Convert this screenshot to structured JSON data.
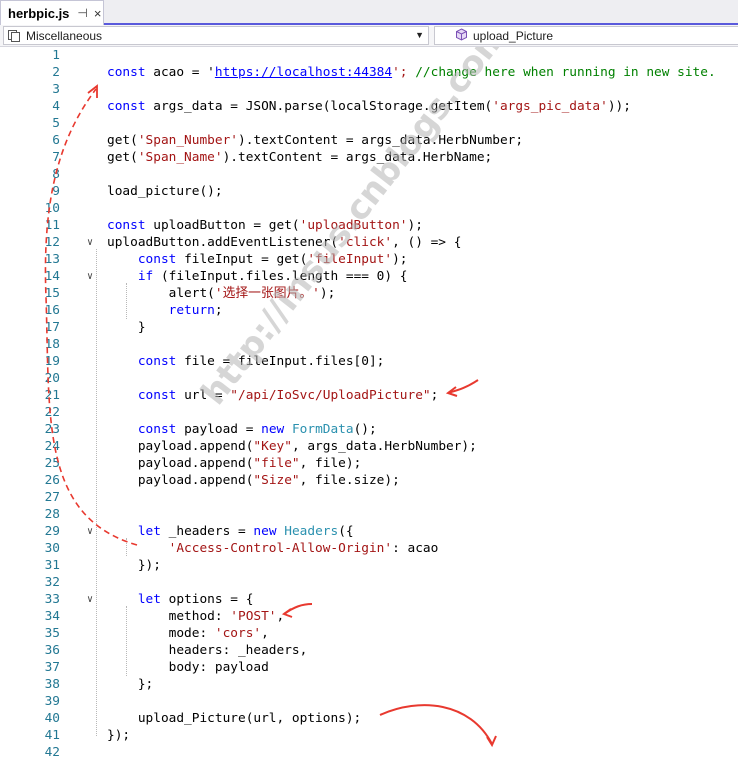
{
  "tab": {
    "title": "herbpic.js",
    "pin": "⊣",
    "close": "×"
  },
  "navbar": {
    "scope": "Miscellaneous",
    "member": "upload_Picture"
  },
  "colors": {
    "keyword": "#0000ff",
    "string": "#a31515",
    "comment": "#008000",
    "line_number": "#237893",
    "annotation": "#e8392f"
  },
  "watermark": "http://insus.cnblogs.com",
  "code": {
    "l2": {
      "kw": "const",
      "a": " acao = '",
      "url": "https://localhost:44384",
      "b": "'; ",
      "cmt": "//change here when running in new site."
    },
    "l4": {
      "kw": "const",
      "a": " args_data = JSON.parse(localStorage.getItem(",
      "s1": "'args_pic_data'",
      "b": "));"
    },
    "l6": {
      "a": "get(",
      "s1": "'Span_Number'",
      "b": ").textContent = args_data.HerbNumber;"
    },
    "l7": {
      "a": "get(",
      "s1": "'Span_Name'",
      "b": ").textContent = args_data.HerbName;"
    },
    "l9": {
      "a": "load_picture();"
    },
    "l11": {
      "kw": "const",
      "a": " uploadButton = get(",
      "s1": "'uploadButton'",
      "b": ");"
    },
    "l12": {
      "a": "uploadButton.addEventListener(",
      "s1": "'click'",
      "b": ", () => {"
    },
    "l13": {
      "ind": "    ",
      "kw": "const",
      "a": " fileInput = get(",
      "s1": "'fileInput'",
      "b": ");"
    },
    "l14": {
      "ind": "    ",
      "kw": "if",
      "a": " (fileInput.files.length === 0) {"
    },
    "l15": {
      "ind": "        ",
      "a": "alert(",
      "s1": "'选择一张图片。'",
      "b": ");"
    },
    "l16": {
      "ind": "        ",
      "kw": "return",
      "a": ";"
    },
    "l17": {
      "ind": "    ",
      "a": "}"
    },
    "l19": {
      "ind": "    ",
      "kw": "const",
      "a": " file = fileInput.files[0];"
    },
    "l21": {
      "ind": "    ",
      "kw": "const",
      "a": " url = ",
      "s1": "\"/api/IoSvc/UploadPicture\"",
      "b": ";"
    },
    "l23": {
      "ind": "    ",
      "kw": "const",
      "a": " payload = ",
      "kw2": "new",
      "sp": " ",
      "ty": "FormData",
      "b": "();"
    },
    "l24": {
      "ind": "    ",
      "a": "payload.append(",
      "s1": "\"Key\"",
      "b": ", args_data.HerbNumber);"
    },
    "l25": {
      "ind": "    ",
      "a": "payload.append(",
      "s1": "\"file\"",
      "b": ", file);"
    },
    "l26": {
      "ind": "    ",
      "a": "payload.append(",
      "s1": "\"Size\"",
      "b": ", file.size);"
    },
    "l29": {
      "ind": "    ",
      "kw": "let",
      "a": " _headers = ",
      "kw2": "new",
      "sp": " ",
      "ty": "Headers",
      "b": "({"
    },
    "l30": {
      "ind": "        ",
      "s1": "'Access-Control-Allow-Origin'",
      "b": ": acao"
    },
    "l31": {
      "ind": "    ",
      "a": "});"
    },
    "l33": {
      "ind": "    ",
      "kw": "let",
      "a": " options = {"
    },
    "l34": {
      "ind": "        ",
      "a": "method: ",
      "s1": "'POST'",
      "b": ","
    },
    "l35": {
      "ind": "        ",
      "a": "mode: ",
      "s1": "'cors'",
      "b": ","
    },
    "l36": {
      "ind": "        ",
      "a": "headers: _headers,"
    },
    "l37": {
      "ind": "        ",
      "a": "body: payload"
    },
    "l38": {
      "ind": "    ",
      "a": "};"
    },
    "l40": {
      "ind": "    ",
      "a": "upload_Picture(url, options);"
    },
    "l41": {
      "a": "});"
    }
  },
  "line_numbers": [
    "1",
    "2",
    "3",
    "4",
    "5",
    "6",
    "7",
    "8",
    "9",
    "10",
    "11",
    "12",
    "13",
    "14",
    "15",
    "16",
    "17",
    "18",
    "19",
    "20",
    "21",
    "22",
    "23",
    "24",
    "25",
    "26",
    "27",
    "28",
    "29",
    "30",
    "31",
    "32",
    "33",
    "34",
    "35",
    "36",
    "37",
    "38",
    "39",
    "40",
    "41",
    "42"
  ]
}
